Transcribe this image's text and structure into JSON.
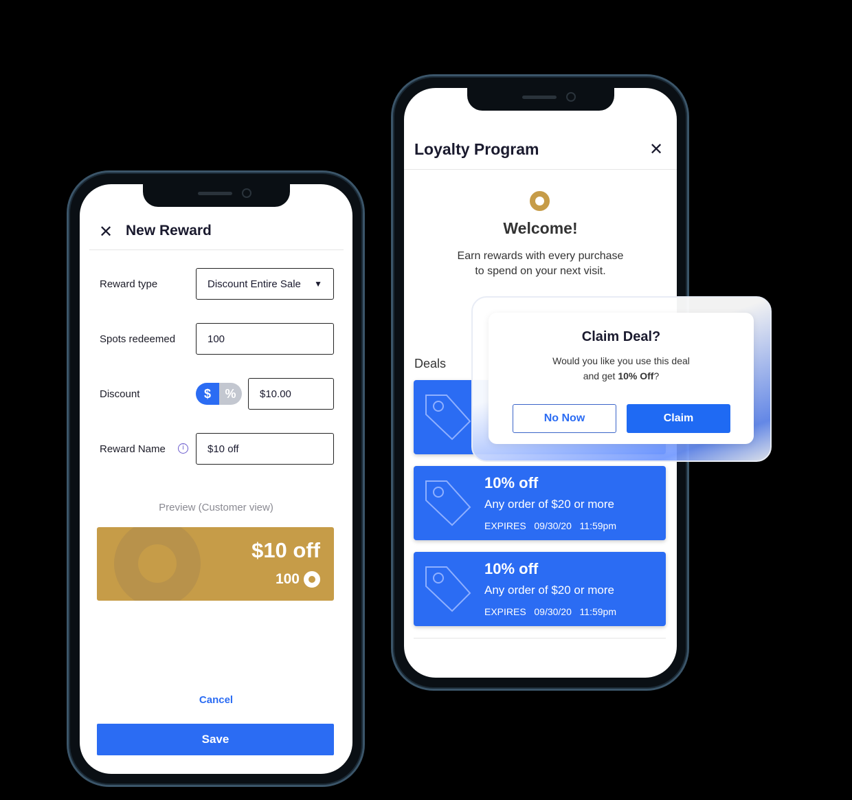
{
  "left": {
    "title": "New Reward",
    "reward_type_label": "Reward type",
    "reward_type_value": "Discount Entire Sale",
    "spots_label": "Spots redeemed",
    "spots_value": "100",
    "discount_label": "Discount",
    "toggle_dollar": "$",
    "toggle_percent": "%",
    "discount_value": "$10.00",
    "reward_name_label": "Reward Name",
    "reward_name_value": "$10 off",
    "preview_label": "Preview (Customer view)",
    "preview_title": "$10 off",
    "preview_points": "100",
    "cancel": "Cancel",
    "save": "Save"
  },
  "right": {
    "title": "Loyalty Program",
    "welcome": "Welcome!",
    "subtitle_1": "Earn rewards with every purchase",
    "subtitle_2": "to spend on your next visit.",
    "deals_label": "Deals",
    "deals": [
      {
        "title": "",
        "subtitle": "",
        "expires": ""
      },
      {
        "title": "10% off",
        "subtitle": "Any order of $20 or more",
        "expires_label": "EXPIRES",
        "date": "09/30/20",
        "time": "11:59pm"
      },
      {
        "title": "10% off",
        "subtitle": "Any order of $20 or more",
        "expires_label": "EXPIRES",
        "date": "09/30/20",
        "time": "11:59pm"
      }
    ]
  },
  "dialog": {
    "title": "Claim Deal?",
    "text_1": "Would you like you use this deal",
    "text_2": "and get ",
    "bold": "10% Off",
    "text_3": "?",
    "secondary": "No Now",
    "primary": "Claim"
  },
  "colors": {
    "accent": "#2b6cf3",
    "gold": "#c69c48"
  }
}
